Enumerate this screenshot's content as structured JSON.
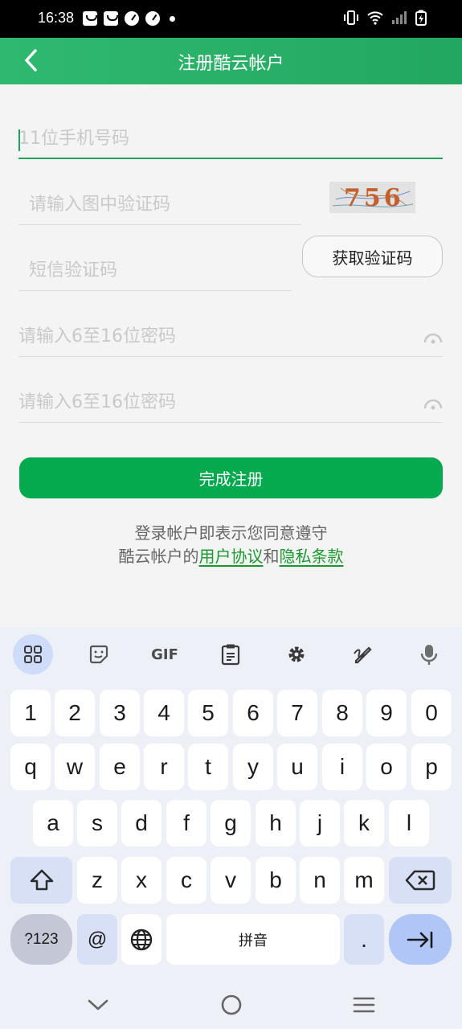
{
  "status_bar": {
    "time": "16:38"
  },
  "header": {
    "title": "注册酷云帐户"
  },
  "form": {
    "phone_placeholder": "11位手机号码",
    "captcha_placeholder": "请输入图中验证码",
    "captcha_text": "756",
    "sms_placeholder": "短信验证码",
    "get_code_label": "获取验证码",
    "password_placeholder": "请输入6至16位密码",
    "confirm_placeholder": "请输入6至16位密码",
    "submit_label": "完成注册"
  },
  "agreement": {
    "line1": "登录帐户即表示您同意遵守",
    "prefix": "酷云帐户的",
    "user_agreement": "用户协议",
    "and": "和",
    "privacy": "隐私条款"
  },
  "keyboard": {
    "toolbar": [
      "apps-icon",
      "sticker-icon",
      "gif-icon",
      "clipboard-icon",
      "gear-icon",
      "handwriting-icon",
      "mic-icon"
    ],
    "gif_label": "GIF",
    "row_numbers": [
      "1",
      "2",
      "3",
      "4",
      "5",
      "6",
      "7",
      "8",
      "9",
      "0"
    ],
    "row1": [
      "q",
      "w",
      "e",
      "r",
      "t",
      "y",
      "u",
      "i",
      "o",
      "p"
    ],
    "row2": [
      "a",
      "s",
      "d",
      "f",
      "g",
      "h",
      "j",
      "k",
      "l"
    ],
    "row3": [
      "z",
      "x",
      "c",
      "v",
      "b",
      "n",
      "m"
    ],
    "sym_label": "?123",
    "at_label": "@",
    "space_label": "拼音",
    "period_label": "."
  },
  "colors": {
    "brand_green": "#05a94e",
    "header_green": "#2fb96f",
    "link_green": "#1a9a2d"
  }
}
